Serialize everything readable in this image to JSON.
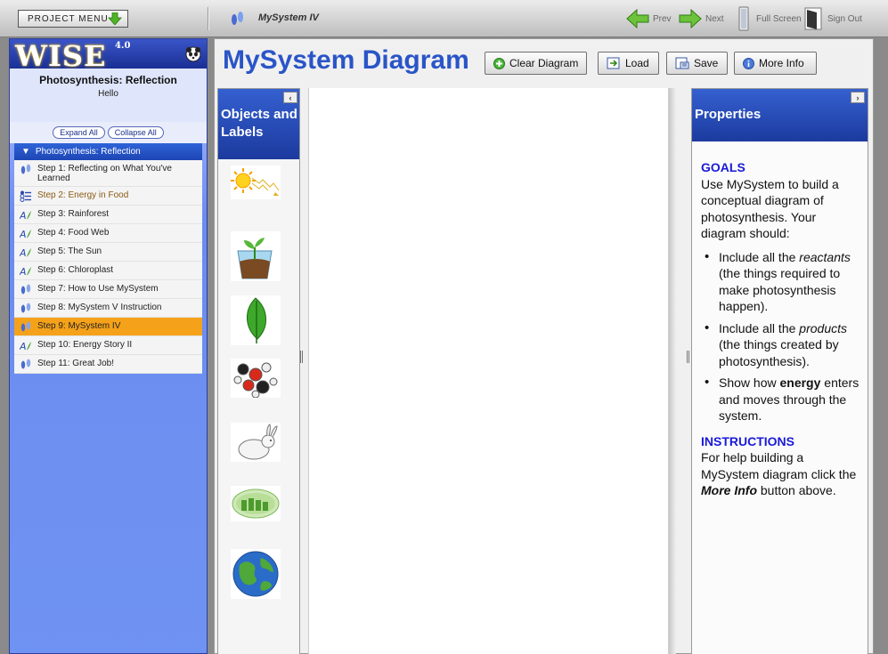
{
  "topbar": {
    "project_menu_label": "PROJECT MENU",
    "current_step_title": "MySystem IV",
    "prev_label": "Prev",
    "next_label": "Next",
    "fullscreen_label": "Full Screen",
    "signout_label": "Sign Out"
  },
  "sidebar": {
    "logo": "WISE",
    "version": "4.0",
    "project_title": "Photosynthesis: Reflection",
    "greeting": "Hello",
    "expand_all": "Expand All",
    "collapse_all": "Collapse All",
    "activity_title": "Photosynthesis: Reflection",
    "steps": [
      {
        "label": "Step 1: Reflecting on What You've Learned",
        "icon": "footprints-icon",
        "state": "normal"
      },
      {
        "label": "Step 2: Energy in Food",
        "icon": "multiple-choice-icon",
        "state": "visited"
      },
      {
        "label": "Step 3: Rainforest",
        "icon": "annotated-drawing-icon",
        "state": "normal"
      },
      {
        "label": "Step 4: Food Web",
        "icon": "annotated-drawing-icon",
        "state": "normal"
      },
      {
        "label": "Step 5: The Sun",
        "icon": "annotated-drawing-icon",
        "state": "normal"
      },
      {
        "label": "Step 6: Chloroplast",
        "icon": "annotated-drawing-icon",
        "state": "normal"
      },
      {
        "label": "Step 7: How to Use MySystem",
        "icon": "footprints-icon",
        "state": "normal"
      },
      {
        "label": "Step 8: MySystem V Instruction",
        "icon": "footprints-icon",
        "state": "normal"
      },
      {
        "label": "Step 9: MySystem IV",
        "icon": "footprints-icon",
        "state": "active"
      },
      {
        "label": "Step 10: Energy Story II",
        "icon": "annotated-drawing-icon",
        "state": "normal"
      },
      {
        "label": "Step 11: Great Job!",
        "icon": "footprints-icon",
        "state": "normal"
      }
    ]
  },
  "main": {
    "title": "MySystem Diagram",
    "buttons": {
      "clear": "Clear Diagram",
      "load": "Load",
      "save": "Save",
      "more_info": "More Info"
    },
    "objects_panel_title": "Objects and Labels",
    "objects": [
      "sun-icon",
      "potted-plant-icon",
      "leaf-icon",
      "molecule-icon",
      "rabbit-icon",
      "chloroplast-icon",
      "earth-icon"
    ],
    "properties_title": "Properties",
    "goals_heading": "GOALS",
    "goals_intro": "Use MySystem to build a conceptual diagram of photosynthesis. Your diagram should:",
    "goal_items": [
      {
        "pre": "Include all the ",
        "em": "reactants",
        "post": " (the things required to make photosynthesis happen)."
      },
      {
        "pre": "Include all the ",
        "em": "products",
        "post": " (the things created by photosynthesis)."
      },
      {
        "pre": "Show how ",
        "strong": "energy",
        "post": " enters and moves through the system."
      }
    ],
    "instructions_heading": "INSTRUCTIONS",
    "instructions_pre": "For help building a MySystem diagram click the ",
    "instructions_em": "More Info",
    "instructions_post": " button above."
  },
  "colors": {
    "accent_blue": "#2a55c8",
    "active_step": "#f5a21a",
    "panel_header": "#1c3a9e"
  }
}
